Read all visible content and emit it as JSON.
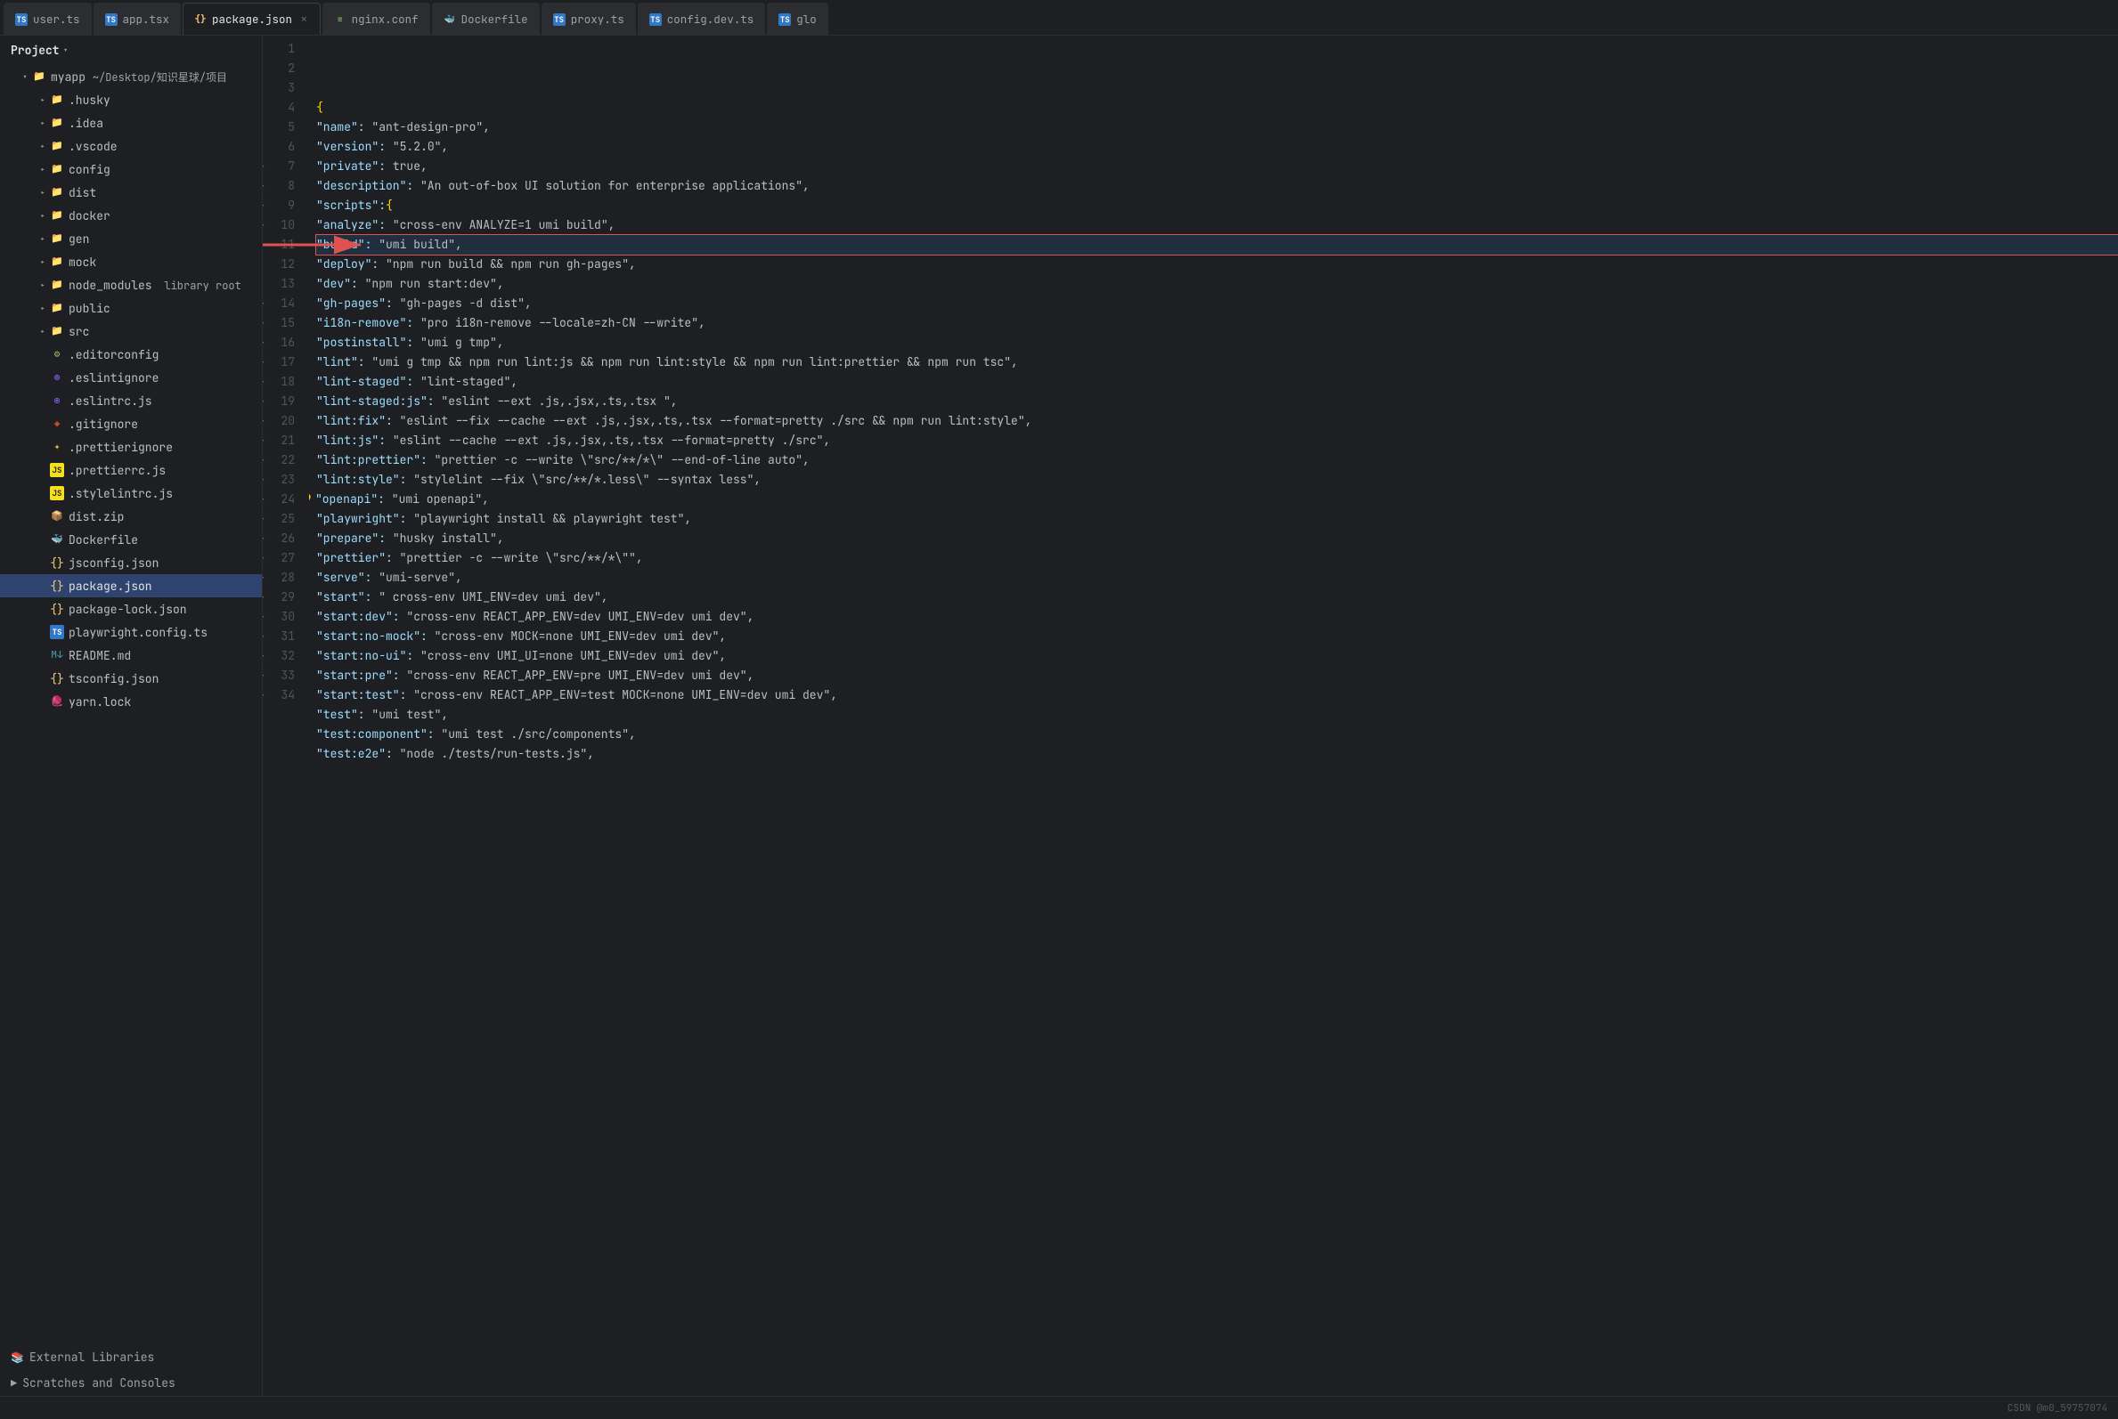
{
  "app": {
    "title": "Project"
  },
  "tabs": [
    {
      "id": "user-ts",
      "icon": "ts",
      "label": "user.ts",
      "active": false,
      "closeable": false
    },
    {
      "id": "app-tsx",
      "icon": "tsx",
      "label": "app.tsx",
      "active": false,
      "closeable": false
    },
    {
      "id": "package-json",
      "icon": "json",
      "label": "package.json",
      "active": true,
      "closeable": true
    },
    {
      "id": "nginx-conf",
      "icon": "conf",
      "label": "nginx.conf",
      "active": false,
      "closeable": false
    },
    {
      "id": "dockerfile",
      "icon": "docker",
      "label": "Dockerfile",
      "active": false,
      "closeable": false
    },
    {
      "id": "proxy-ts",
      "icon": "ts",
      "label": "proxy.ts",
      "active": false,
      "closeable": false
    },
    {
      "id": "config-dev-ts",
      "icon": "ts",
      "label": "config.dev.ts",
      "active": false,
      "closeable": false
    },
    {
      "id": "glo",
      "icon": "ts",
      "label": "glo",
      "active": false,
      "closeable": false
    }
  ],
  "sidebar": {
    "project_label": "Project",
    "root": {
      "name": "myapp",
      "path": "~/Desktop/知识星球/项目",
      "children": [
        {
          "id": "husky",
          "name": ".husky",
          "type": "folder",
          "indent": 1,
          "expanded": false
        },
        {
          "id": "idea",
          "name": ".idea",
          "type": "folder",
          "indent": 1,
          "expanded": false
        },
        {
          "id": "vscode",
          "name": ".vscode",
          "type": "folder",
          "indent": 1,
          "expanded": false
        },
        {
          "id": "config",
          "name": "config",
          "type": "folder",
          "indent": 1,
          "expanded": false
        },
        {
          "id": "dist",
          "name": "dist",
          "type": "folder-dist",
          "indent": 1,
          "expanded": false
        },
        {
          "id": "docker",
          "name": "docker",
          "type": "folder",
          "indent": 1,
          "expanded": false
        },
        {
          "id": "gen",
          "name": "gen",
          "type": "folder",
          "indent": 1,
          "expanded": false
        },
        {
          "id": "mock",
          "name": "mock",
          "type": "folder",
          "indent": 1,
          "expanded": false
        },
        {
          "id": "node_modules",
          "name": "node_modules",
          "type": "folder",
          "indent": 1,
          "expanded": false,
          "badge": "library root"
        },
        {
          "id": "public",
          "name": "public",
          "type": "folder",
          "indent": 1,
          "expanded": false
        },
        {
          "id": "src",
          "name": "src",
          "type": "folder",
          "indent": 1,
          "expanded": false
        },
        {
          "id": "editorconfig",
          "name": ".editorconfig",
          "type": "conf-file",
          "indent": 1
        },
        {
          "id": "eslintignore",
          "name": ".eslintignore",
          "type": "eslint-file",
          "indent": 1
        },
        {
          "id": "eslintrc",
          "name": ".eslintrc.js",
          "type": "eslint-file",
          "indent": 1
        },
        {
          "id": "gitignore",
          "name": ".gitignore",
          "type": "git-file",
          "indent": 1
        },
        {
          "id": "prettierignore",
          "name": ".prettierignore",
          "type": "prettier-file",
          "indent": 1
        },
        {
          "id": "prettierrc",
          "name": ".prettierrc.js",
          "type": "prettier-file",
          "indent": 1
        },
        {
          "id": "stylelintrc",
          "name": ".stylelintrc.js",
          "type": "style-file",
          "indent": 1
        },
        {
          "id": "distzip",
          "name": "dist.zip",
          "type": "zip-file",
          "indent": 1
        },
        {
          "id": "dockerfile2",
          "name": "Dockerfile",
          "type": "docker-file",
          "indent": 1
        },
        {
          "id": "jsconfig",
          "name": "jsconfig.json",
          "type": "json-file",
          "indent": 1
        },
        {
          "id": "packagejson",
          "name": "package.json",
          "type": "json-file",
          "indent": 1,
          "selected": true
        },
        {
          "id": "packagelockjson",
          "name": "package-lock.json",
          "type": "json-file",
          "indent": 1
        },
        {
          "id": "playwrightconfig",
          "name": "playwright.config.ts",
          "type": "ts-file",
          "indent": 1
        },
        {
          "id": "readme",
          "name": "README.md",
          "type": "md-file",
          "indent": 1
        },
        {
          "id": "tsconfig",
          "name": "tsconfig.json",
          "type": "json-file",
          "indent": 1
        },
        {
          "id": "yarnlock",
          "name": "yarn.lock",
          "type": "yarn-file",
          "indent": 1
        }
      ]
    },
    "external_libraries": "External Libraries",
    "scratches": "Scratches and Consoles"
  },
  "editor": {
    "lines": [
      {
        "num": 1,
        "code": "{",
        "hasRun": false,
        "highlight": false
      },
      {
        "num": 2,
        "code": "  \"name\": \"ant-design-pro\",",
        "hasRun": false
      },
      {
        "num": 3,
        "code": "  \"version\": \"5.2.0\",",
        "hasRun": false
      },
      {
        "num": 4,
        "code": "  \"private\": true,",
        "hasRun": false
      },
      {
        "num": 5,
        "code": "  \"description\": \"An out-of-box UI solution for enterprise applications\",",
        "hasRun": false
      },
      {
        "num": 6,
        "code": "  \"scripts\": {",
        "hasRun": false
      },
      {
        "num": 7,
        "code": "    \"analyze\": \"cross-env ANALYZE=1 umi build\",",
        "hasRun": true
      },
      {
        "num": 8,
        "code": "    \"build\": \"umi build\",",
        "hasRun": true,
        "boxed": true
      },
      {
        "num": 9,
        "code": "    \"deploy\": \"npm run build && npm run gh-pages\",",
        "hasRun": true
      },
      {
        "num": 10,
        "code": "    \"dev\": \"npm run start:dev\",",
        "hasRun": true
      },
      {
        "num": 11,
        "code": "    \"gh-pages\": \"gh-pages -d dist\",",
        "hasRun": false
      },
      {
        "num": 12,
        "code": "    \"i18n-remove\": \"pro i18n-remove --locale=zh-CN --write\",",
        "hasRun": false
      },
      {
        "num": 13,
        "code": "    \"postinstall\": \"umi g tmp\",",
        "hasRun": false
      },
      {
        "num": 14,
        "code": "    \"lint\": \"umi g tmp && npm run lint:js && npm run lint:style && npm run lint:prettier && npm run tsc\",",
        "hasRun": true
      },
      {
        "num": 15,
        "code": "    \"lint-staged\": \"lint-staged\",",
        "hasRun": true
      },
      {
        "num": 16,
        "code": "    \"lint-staged:js\": \"eslint --ext .js,.jsx,.ts,.tsx \",",
        "hasRun": true
      },
      {
        "num": 17,
        "code": "    \"lint:fix\": \"eslint --fix --cache --ext .js,.jsx,.ts,.tsx --format=pretty ./src && npm run lint:style\",",
        "hasRun": true
      },
      {
        "num": 18,
        "code": "    \"lint:js\": \"eslint --cache --ext .js,.jsx,.ts,.tsx --format=pretty ./src\",",
        "hasRun": true
      },
      {
        "num": 19,
        "code": "    \"lint:prettier\": \"prettier -c --write \\\"src/**/*\\\" --end-of-line auto\",",
        "hasRun": true
      },
      {
        "num": 20,
        "code": "    \"lint:style\": \"stylelint --fix \\\"src/**/*.less\\\" --syntax less\",",
        "hasRun": true
      },
      {
        "num": 21,
        "code": "    \"openapi\": \"umi openapi\",",
        "hasRun": true,
        "bulb": true
      },
      {
        "num": 22,
        "code": "    \"playwright\": \"playwright install && playwright test\",",
        "hasRun": true
      },
      {
        "num": 23,
        "code": "    \"prepare\": \"husky install\",",
        "hasRun": true
      },
      {
        "num": 24,
        "code": "    \"prettier\": \"prettier -c --write \\\"src/**/*\\\"\",",
        "hasRun": true
      },
      {
        "num": 25,
        "code": "    \"serve\": \"umi-serve\",",
        "hasRun": true
      },
      {
        "num": 26,
        "code": "    \"start\": \" cross-env UMI_ENV=dev umi dev\",",
        "hasRun": true
      },
      {
        "num": 27,
        "code": "    \"start:dev\": \"cross-env REACT_APP_ENV=dev UMI_ENV=dev umi dev\",",
        "hasRun": true
      },
      {
        "num": 28,
        "code": "    \"start:no-mock\": \"cross-env MOCK=none UMI_ENV=dev umi dev\",",
        "hasRun": true
      },
      {
        "num": 29,
        "code": "    \"start:no-ui\": \"cross-env UMI_UI=none UMI_ENV=dev umi dev\",",
        "hasRun": true
      },
      {
        "num": 30,
        "code": "    \"start:pre\": \"cross-env REACT_APP_ENV=pre UMI_ENV=dev umi dev\",",
        "hasRun": true
      },
      {
        "num": 31,
        "code": "    \"start:test\": \"cross-env REACT_APP_ENV=test MOCK=none UMI_ENV=dev umi dev\",",
        "hasRun": true
      },
      {
        "num": 32,
        "code": "    \"test\": \"umi test\",",
        "hasRun": true
      },
      {
        "num": 33,
        "code": "    \"test:component\": \"umi test ./src/components\",",
        "hasRun": true
      },
      {
        "num": 34,
        "code": "    \"test:e2e\": \"node ./tests/run-tests.js\",",
        "hasRun": true
      }
    ]
  },
  "watermark": "CSDN @m0_59757074"
}
